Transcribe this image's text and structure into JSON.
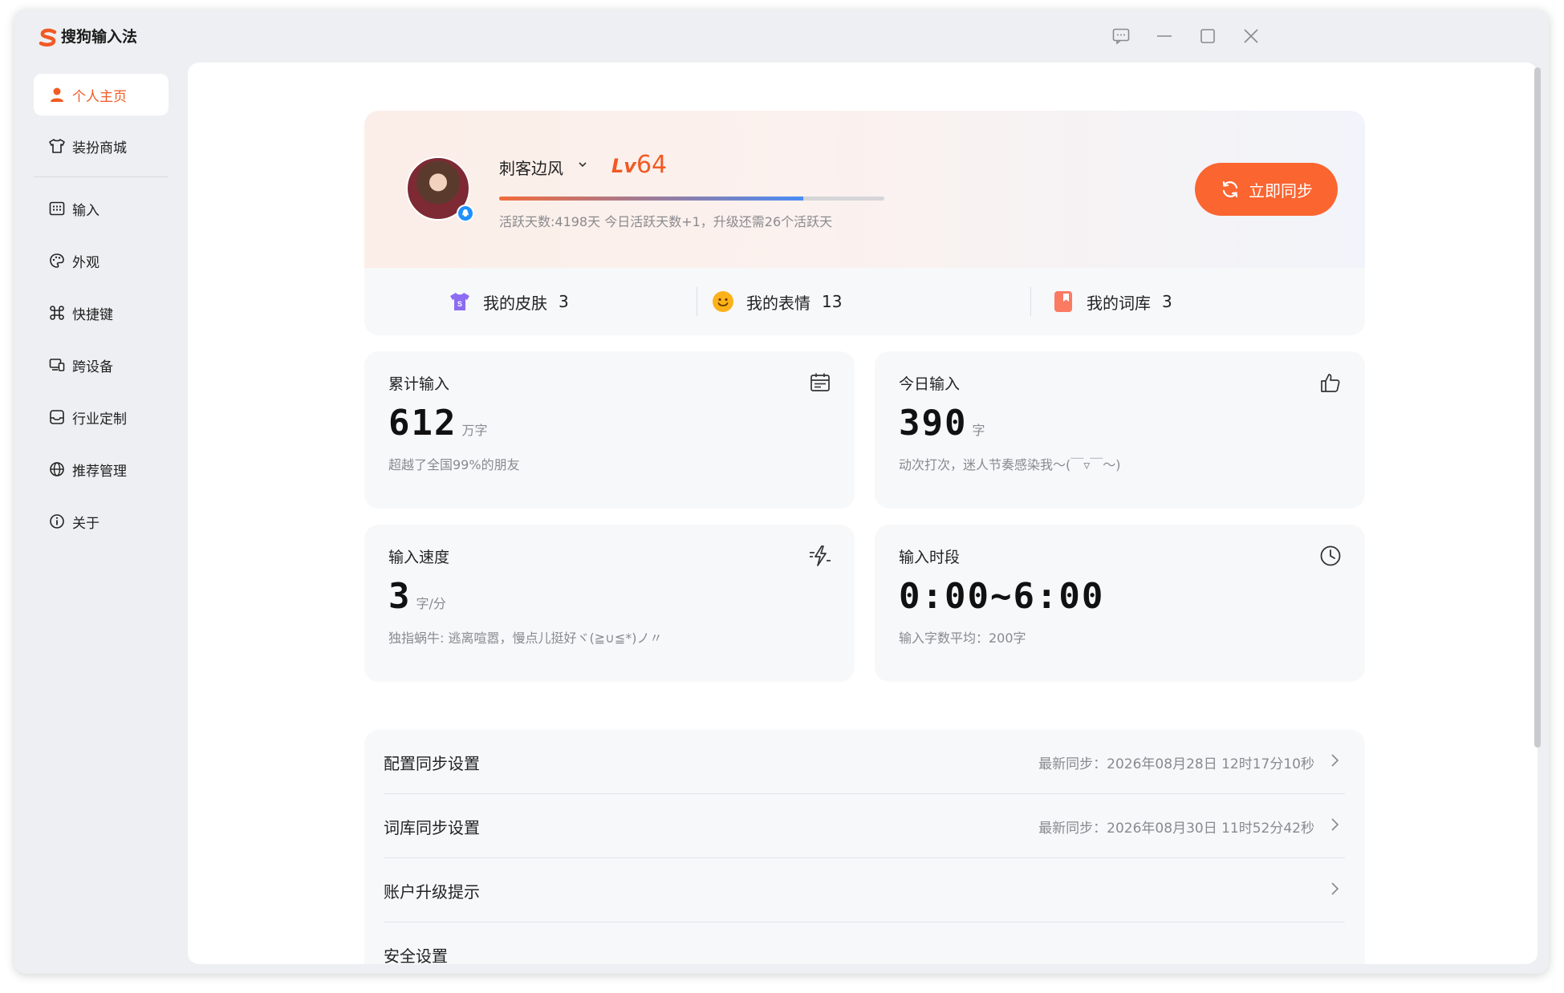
{
  "app": {
    "title": "搜狗输入法"
  },
  "sidebar": {
    "items": [
      {
        "label": "个人主页",
        "icon": "user-icon",
        "active": true
      },
      {
        "label": "装扮商城",
        "icon": "tshirt-icon"
      },
      {
        "label": "输入",
        "icon": "keyboard-icon"
      },
      {
        "label": "外观",
        "icon": "palette-icon"
      },
      {
        "label": "快捷键",
        "icon": "command-icon"
      },
      {
        "label": "跨设备",
        "icon": "devices-icon"
      },
      {
        "label": "行业定制",
        "icon": "tray-icon"
      },
      {
        "label": "推荐管理",
        "icon": "globe-icon"
      },
      {
        "label": "关于",
        "icon": "info-icon"
      }
    ]
  },
  "profile": {
    "username": "刺客边风",
    "level_prefix": "Lv",
    "level": "64",
    "exp_progress": 0.79,
    "exp_text": "活跃天数:4198天 今日活跃天数+1，升级还需26个活跃天",
    "sync_button": "立即同步"
  },
  "stats": [
    {
      "label": "我的皮肤",
      "count": "3"
    },
    {
      "label": "我的表情",
      "count": "13"
    },
    {
      "label": "我的词库",
      "count": "3"
    }
  ],
  "cards": [
    {
      "label": "累计输入",
      "value": "612",
      "unit": "万字",
      "desc": "超越了全国99%的朋友",
      "icon": "calendar-icon"
    },
    {
      "label": "今日输入",
      "value": "390",
      "unit": "字",
      "desc": "动次打次，迷人节奏感染我～(￣▿￣～)",
      "icon": "thumbs-up-icon"
    },
    {
      "label": "输入速度",
      "value": "3",
      "unit": "字/分",
      "desc": "独指蜗牛: 逃离喧嚣，慢点儿挺好ヾ(≧∪≦*)ノ〃",
      "icon": "lightning-icon"
    },
    {
      "label": "输入时段",
      "value": "0:00~6:00",
      "unit": "",
      "desc": "输入字数平均：200字",
      "icon": "clock-icon"
    }
  ],
  "settings": [
    {
      "label": "配置同步设置",
      "status": "最新同步：2026年08月28日 12时17分10秒"
    },
    {
      "label": "词库同步设置",
      "status": "最新同步：2026年08月30日 11时52分42秒"
    },
    {
      "label": "账户升级提示",
      "status": ""
    },
    {
      "label": "安全设置",
      "status": ""
    }
  ],
  "colors": {
    "accent": "#f15a24",
    "button": "#fb6530",
    "progress_end": "#4a8cf6"
  }
}
